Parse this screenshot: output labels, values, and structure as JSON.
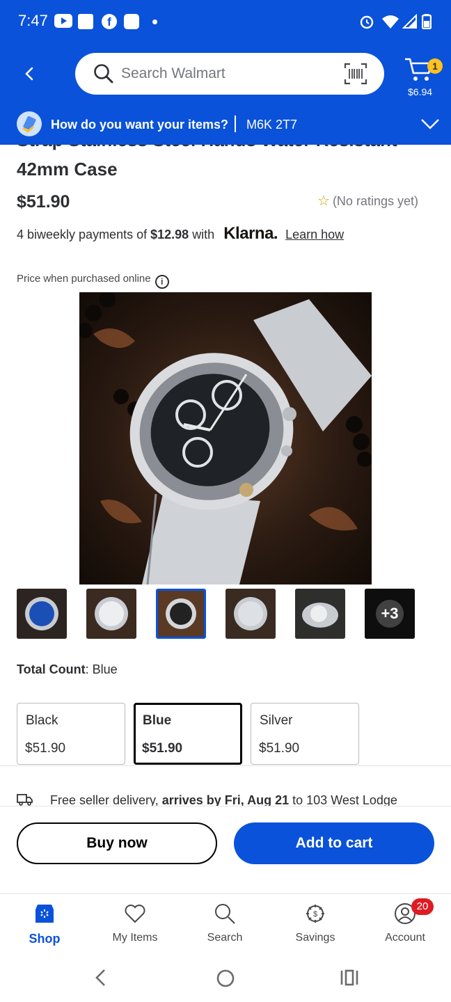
{
  "status_bar": {
    "time": "7:47"
  },
  "header": {
    "search_placeholder": "Search Walmart",
    "cart_count": "1",
    "cart_total": "$6.94"
  },
  "fulfillment": {
    "question": "How do you want your items?",
    "postal_code": "M6K 2T7"
  },
  "product": {
    "title_cut": "Strap Stainless Steel Hands Water Resistant",
    "title_line2": "42mm Case",
    "price": "$51.90",
    "rating_text": "(No ratings yet)",
    "klarna": {
      "prefix": "4 biweekly payments of",
      "amount": "$12.98",
      "with": "with",
      "logo": "Klarna.",
      "link": "Learn how"
    },
    "price_note": "Price when purchased online",
    "thumbnails_more": "+3",
    "variant": {
      "label": "Total Count",
      "value": ": Blue"
    },
    "options": [
      {
        "name": "Black",
        "price": "$51.90"
      },
      {
        "name": "Blue",
        "price": "$51.90"
      },
      {
        "name": "Silver",
        "price": "$51.90"
      }
    ],
    "delivery": {
      "pre": "Free seller delivery, ",
      "bold": "arrives by Fri, Aug 21",
      "post": " to 103 West Lodge"
    }
  },
  "actions": {
    "buy_now": "Buy now",
    "add_to_cart": "Add to cart"
  },
  "tabs": [
    {
      "label": "Shop",
      "icon": "shop-icon"
    },
    {
      "label": "My Items",
      "icon": "heart-icon"
    },
    {
      "label": "Search",
      "icon": "search-icon"
    },
    {
      "label": "Savings",
      "icon": "savings-icon"
    },
    {
      "label": "Account",
      "icon": "account-icon",
      "badge": "20"
    }
  ],
  "colors": {
    "brand_blue": "#0a52d9",
    "spark_yellow": "#ffc220",
    "badge_red": "#de1c24"
  }
}
